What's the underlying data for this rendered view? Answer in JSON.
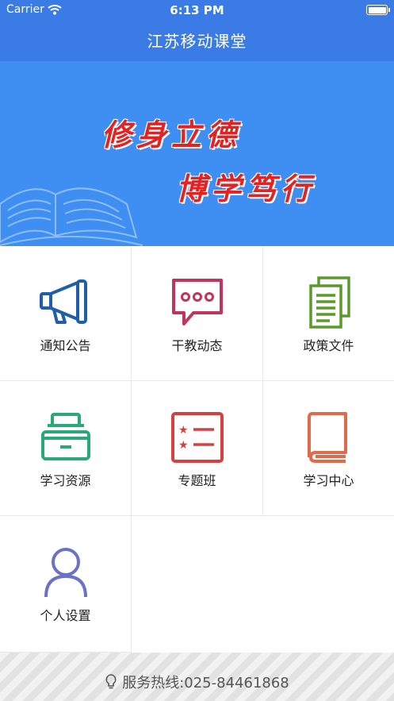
{
  "status_bar": {
    "carrier": "Carrier",
    "time": "6:13 PM"
  },
  "header": {
    "title": "江苏移动课堂"
  },
  "banner": {
    "slogan_line1": "修身立德",
    "slogan_line2": "博学笃行"
  },
  "menu": [
    {
      "label": "通知公告",
      "icon": "megaphone-icon",
      "color": "#1f5fa8"
    },
    {
      "label": "干教动态",
      "icon": "chat-bubble-icon",
      "color": "#c2355a"
    },
    {
      "label": "政策文件",
      "icon": "documents-icon",
      "color": "#5a9a2c"
    },
    {
      "label": "学习资源",
      "icon": "archive-drawer-icon",
      "color": "#2aa876"
    },
    {
      "label": "专题班",
      "icon": "starred-list-icon",
      "color": "#d84040"
    },
    {
      "label": "学习中心",
      "icon": "book-icon",
      "color": "#e06a4a"
    },
    {
      "label": "个人设置",
      "icon": "user-icon",
      "color": "#6a72c8"
    }
  ],
  "footer": {
    "hotline": "服务热线:025-84461868"
  }
}
